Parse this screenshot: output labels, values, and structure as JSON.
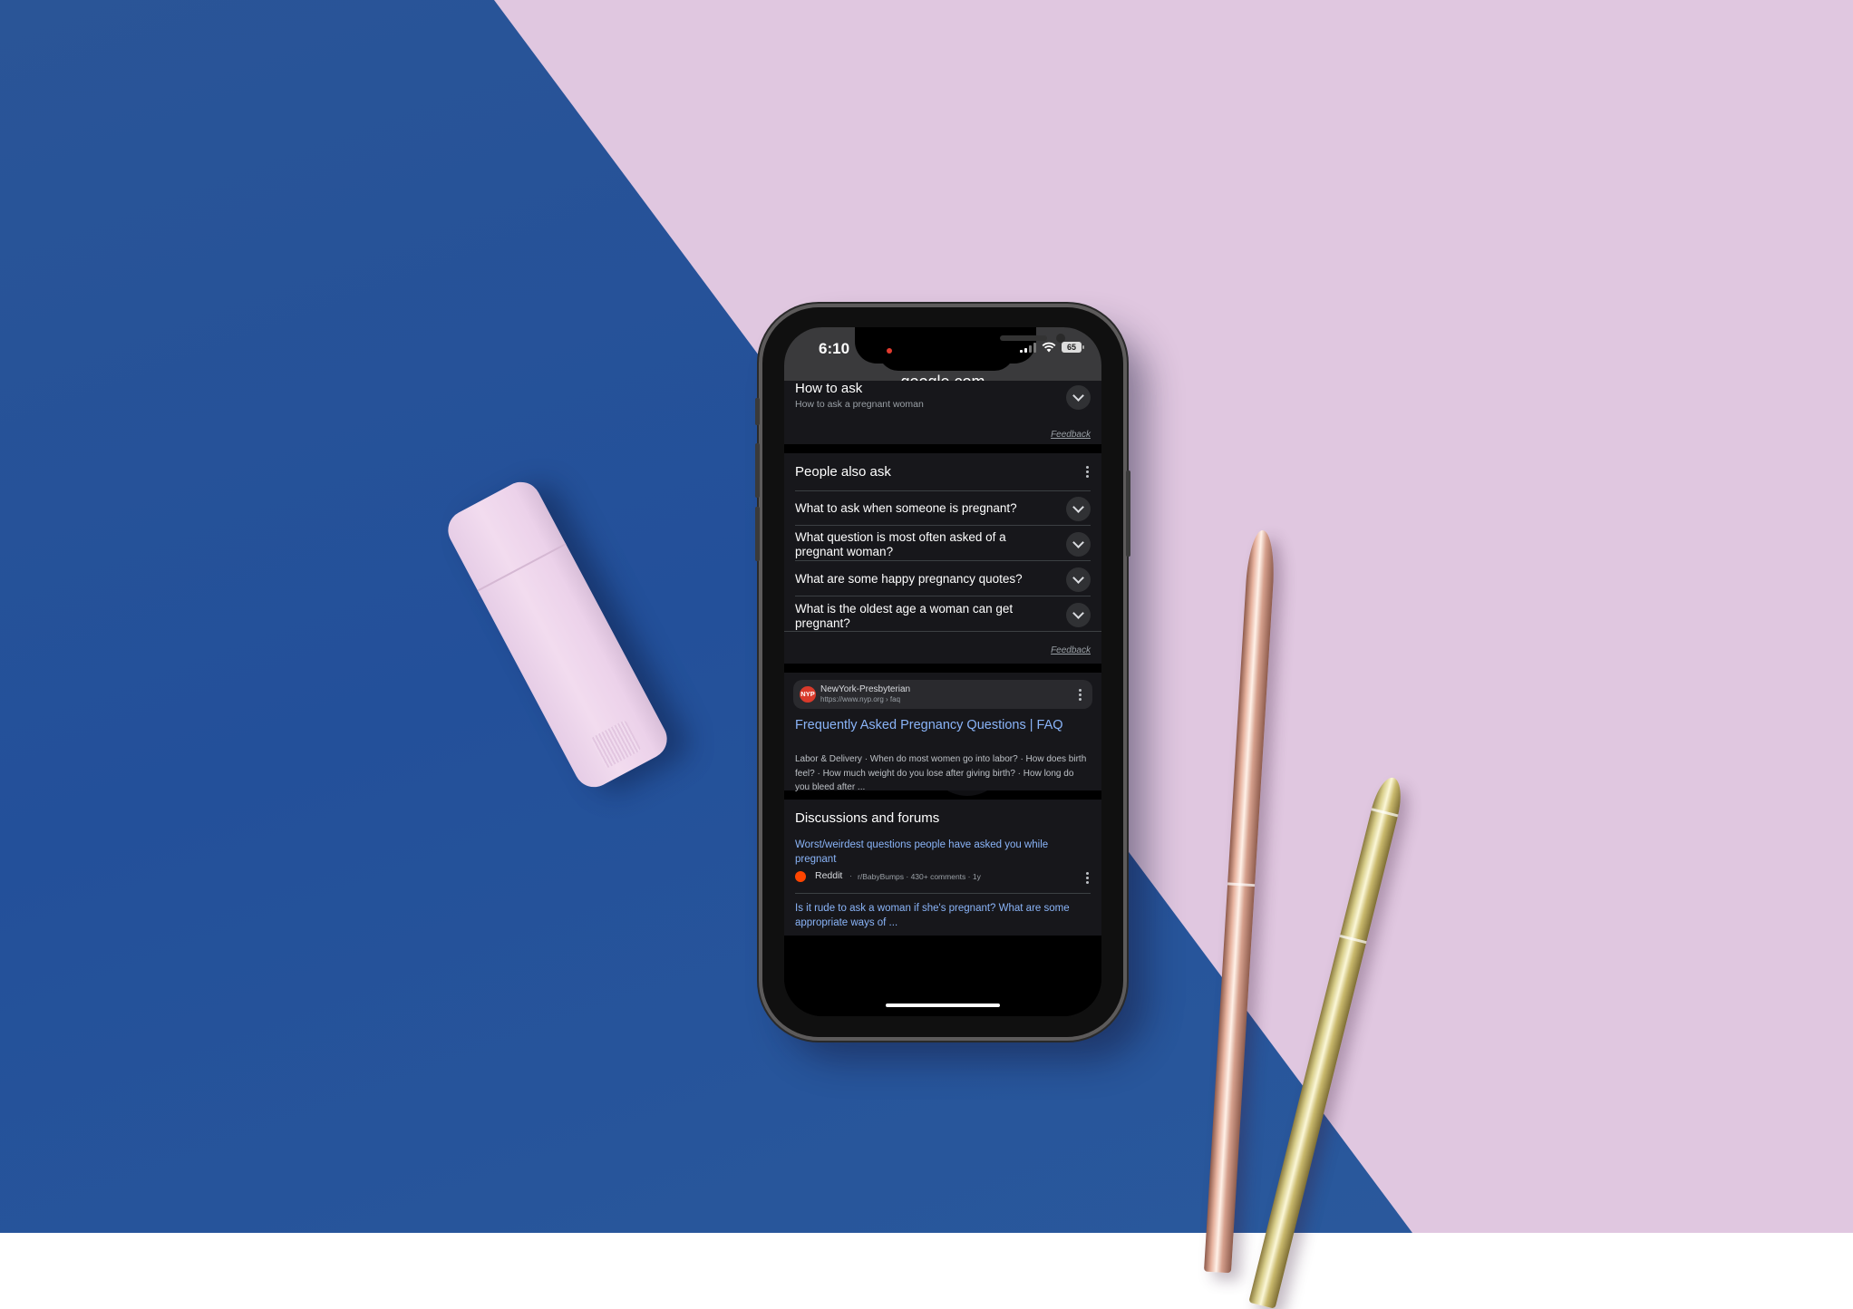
{
  "scene": {
    "colors": {
      "blue_paper": "#2a5597",
      "pink_paper": "#e0c7e0",
      "accent_link": "#8ab4f8",
      "card_bg": "#17171b"
    }
  },
  "status_bar": {
    "time": "6:10",
    "battery": "65",
    "icons": [
      "signal-icon",
      "wifi-icon",
      "battery-icon"
    ]
  },
  "browser": {
    "url": "google.com"
  },
  "top_card": {
    "title": "How to ask",
    "subtitle": "How to ask a pregnant woman",
    "feedback": "Feedback"
  },
  "people_also_ask": {
    "title": "People also ask",
    "questions": [
      "What to ask when someone is pregnant?",
      "What question is most often asked of a pregnant woman?",
      "What are some happy pregnancy quotes?",
      "What is the oldest age a woman can get pregnant?"
    ],
    "feedback": "Feedback"
  },
  "result": {
    "favicon": "NYP",
    "site_name": "NewYork-Presbyterian",
    "url": "https://www.nyp.org › faq",
    "title": "Frequently Asked Pregnancy Questions | FAQ",
    "snippet": "Labor & Delivery · When do most women go into labor? · How does birth feel? · How much weight do you lose after giving birth? · How long do you bleed after ..."
  },
  "discussions": {
    "title": "Discussions and forums",
    "items": [
      {
        "title": "Worst/weirdest questions people have asked you while pregnant",
        "source": "Reddit",
        "meta": "r/BabyBumps · 430+ comments · 1y"
      },
      {
        "title": "Is it rude to ask a woman if she's pregnant? What are some appropriate ways of ..."
      }
    ]
  }
}
